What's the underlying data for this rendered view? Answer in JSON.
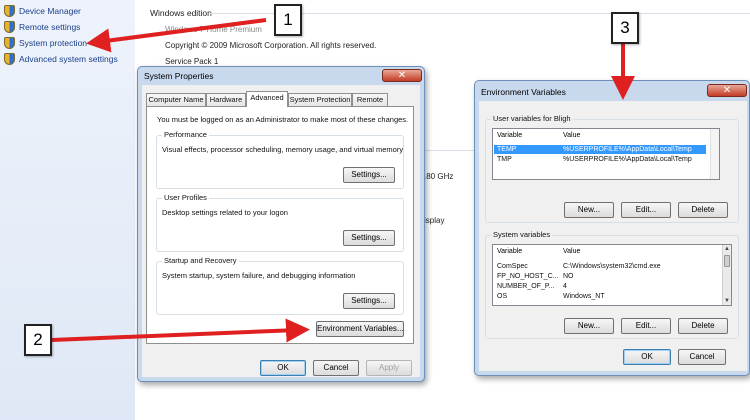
{
  "sidebar": {
    "items": [
      {
        "label": "Device Manager"
      },
      {
        "label": "Remote settings"
      },
      {
        "label": "System protection"
      },
      {
        "label": "Advanced system settings"
      }
    ]
  },
  "background_page": {
    "section_heading": "Windows edition",
    "edition_partial": "Windows 7 Home Premium",
    "copyright": "Copyright © 2009 Microsoft Corporation.  All rights reserved.",
    "service_pack": "Service Pack 1",
    "cpu_partial": ".80 GHz",
    "display_partial": "isplay"
  },
  "system_properties": {
    "title": "System Properties",
    "tabs": [
      "Computer Name",
      "Hardware",
      "Advanced",
      "System Protection",
      "Remote"
    ],
    "active_tab": "Advanced",
    "admin_note": "You must be logged on as an Administrator to make most of these changes.",
    "performance": {
      "label": "Performance",
      "description": "Visual effects, processor scheduling, memory usage, and virtual memory",
      "button": "Settings..."
    },
    "user_profiles": {
      "label": "User Profiles",
      "description": "Desktop settings related to your logon",
      "button": "Settings..."
    },
    "startup_recovery": {
      "label": "Startup and Recovery",
      "description": "System startup, system failure, and debugging information",
      "button": "Settings..."
    },
    "env_button": "Environment Variables...",
    "ok": "OK",
    "cancel": "Cancel",
    "apply": "Apply"
  },
  "env_variables": {
    "title": "Environment Variables",
    "user_section": "User variables for Bligh",
    "system_section": "System variables",
    "col_variable": "Variable",
    "col_value": "Value",
    "user_vars": [
      {
        "variable": "TEMP",
        "value": "%USERPROFILE%\\AppData\\Local\\Temp",
        "selected": true
      },
      {
        "variable": "TMP",
        "value": "%USERPROFILE%\\AppData\\Local\\Temp",
        "selected": false
      }
    ],
    "system_vars": [
      {
        "variable": "ComSpec",
        "value": "C:\\Windows\\system32\\cmd.exe"
      },
      {
        "variable": "FP_NO_HOST_C...",
        "value": "NO"
      },
      {
        "variable": "NUMBER_OF_P...",
        "value": "4"
      },
      {
        "variable": "OS",
        "value": "Windows_NT"
      }
    ],
    "new_btn": "New...",
    "edit_btn": "Edit...",
    "delete_btn": "Delete",
    "ok": "OK",
    "cancel": "Cancel"
  },
  "callouts": [
    "1",
    "2",
    "3"
  ],
  "colors": {
    "arrow": "#e02020",
    "selection": "#3399ff",
    "link": "#1a3f8c"
  }
}
